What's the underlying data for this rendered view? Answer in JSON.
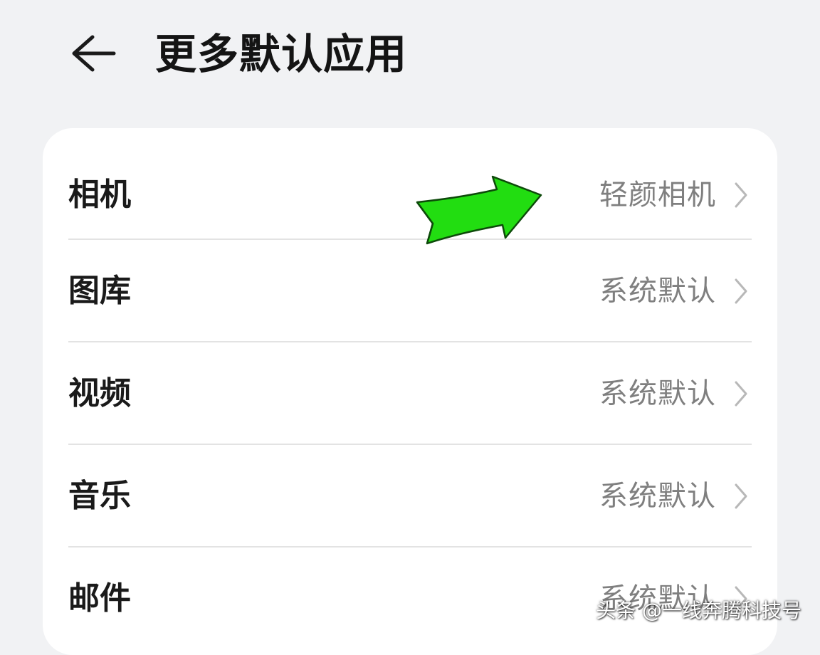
{
  "header": {
    "back_icon": "arrow-left-icon",
    "title": "更多默认应用"
  },
  "items": [
    {
      "label": "相机",
      "value": "轻颜相机",
      "icon": "chevron-right-icon"
    },
    {
      "label": "图库",
      "value": "系统默认",
      "icon": "chevron-right-icon"
    },
    {
      "label": "视频",
      "value": "系统默认",
      "icon": "chevron-right-icon"
    },
    {
      "label": "音乐",
      "value": "系统默认",
      "icon": "chevron-right-icon"
    },
    {
      "label": "邮件",
      "value": "系统默认",
      "icon": "chevron-right-icon"
    }
  ],
  "annotation": {
    "icon": "green-arrow-icon",
    "color": "#22dd11"
  },
  "watermark": "头条 @一线奔腾科技号",
  "colors": {
    "background": "#f1f2f4",
    "card": "#ffffff",
    "label": "#1a1a1a",
    "value": "#7f7f7f",
    "divider": "#e3e3e3"
  }
}
